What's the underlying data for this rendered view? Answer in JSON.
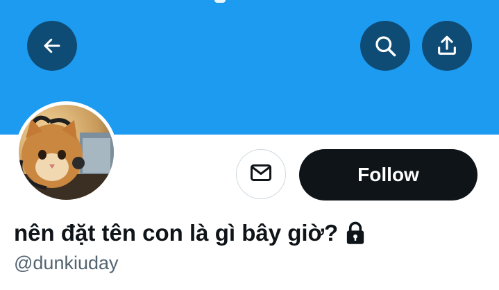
{
  "profile": {
    "display_name": "nên đặt tên con là gì bây giờ?",
    "handle": "@dunkiuday",
    "protected": true
  },
  "actions": {
    "follow_label": "Follow"
  },
  "icons": {
    "back": "arrow-left-icon",
    "search": "search-icon",
    "share": "share-upload-icon",
    "message": "envelope-icon",
    "protected": "lock-icon"
  },
  "colors": {
    "banner": "#1d9bf0",
    "header_button": "#0f4c75",
    "follow_button": "#0f1419",
    "handle_text": "#536471"
  }
}
